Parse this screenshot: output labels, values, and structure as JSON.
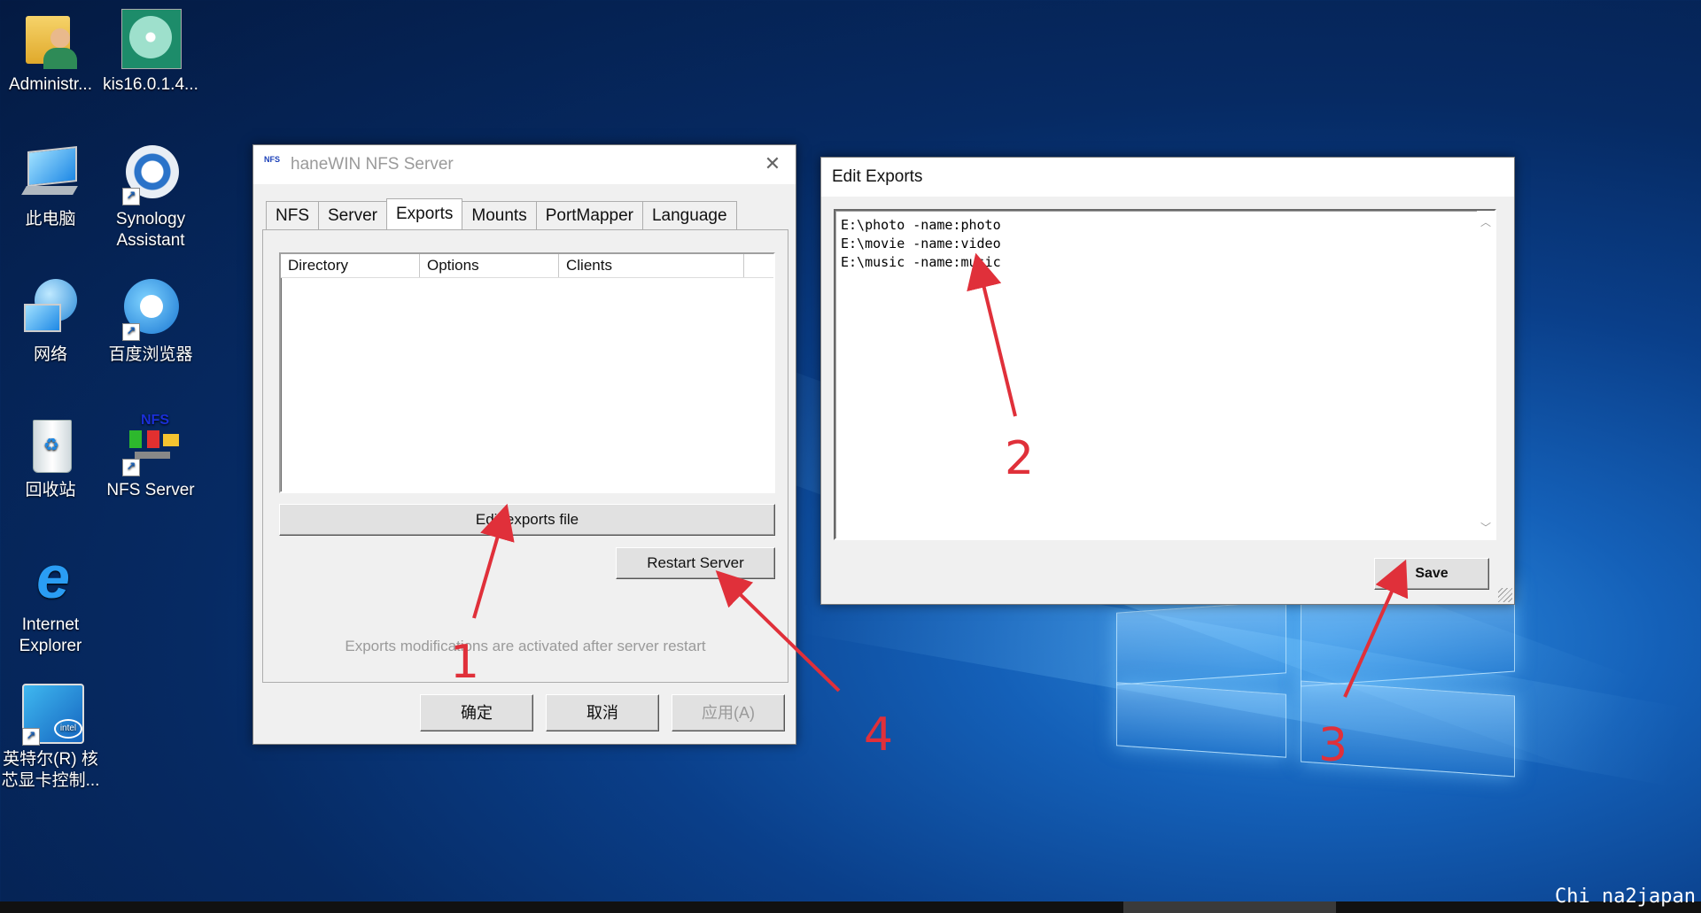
{
  "desktop": {
    "icons": [
      {
        "label": "Administr...",
        "icon": "user-folder-icon"
      },
      {
        "label": "kis16.0.1.4...",
        "icon": "disc-icon"
      },
      {
        "label": "此电脑",
        "icon": "computer-icon"
      },
      {
        "label": "Synology Assistant",
        "icon": "synology-icon"
      },
      {
        "label": "网络",
        "icon": "network-icon"
      },
      {
        "label": "百度浏览器",
        "icon": "browser-icon"
      },
      {
        "label": "回收站",
        "icon": "recycle-bin-icon"
      },
      {
        "label": "NFS Server",
        "icon": "nfs-icon"
      },
      {
        "label": "Internet Explorer",
        "icon": "ie-icon"
      },
      {
        "label": "英特尔(R) 核芯显卡控制...",
        "icon": "intel-graphics-icon"
      }
    ]
  },
  "nfs_window": {
    "title": "haneWIN NFS Server",
    "app_icon_text": "NFS",
    "tabs": [
      "NFS",
      "Server",
      "Exports",
      "Mounts",
      "PortMapper",
      "Language"
    ],
    "active_tab": "Exports",
    "columns": [
      "Directory",
      "Options",
      "Clients"
    ],
    "edit_button": "Edit exports file",
    "restart_button": "Restart Server",
    "hint": "Exports modifications are activated after server restart",
    "ok_button": "确定",
    "cancel_button": "取消",
    "apply_button": "应用(A)"
  },
  "edit_window": {
    "title": "Edit Exports",
    "content": "E:\\photo -name:photo\nE:\\movie -name:video\nE:\\music -name:music",
    "save_button": "Save"
  },
  "annotations": {
    "n1": "1",
    "n2": "2",
    "n3": "3",
    "n4": "4",
    "color": "#e0303a"
  },
  "watermark": "Chi na2japan"
}
